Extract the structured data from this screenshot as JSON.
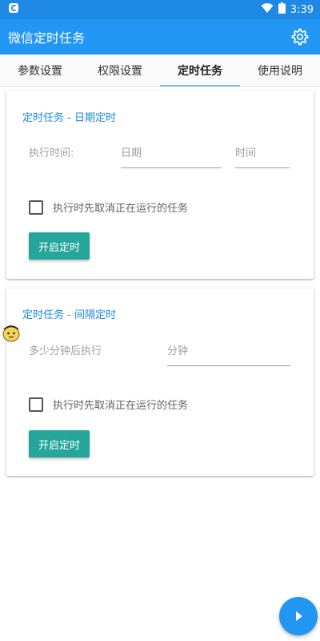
{
  "status_bar": {
    "time": "3:39",
    "icons": [
      "app-notification-icon",
      "wifi-icon",
      "battery-icon"
    ]
  },
  "app_bar": {
    "title": "微信定时任务",
    "settings_icon": "gear-icon"
  },
  "tabs": [
    {
      "label": "参数设置",
      "active": false
    },
    {
      "label": "权限设置",
      "active": false
    },
    {
      "label": "定时任务",
      "active": true
    },
    {
      "label": "使用说明",
      "active": false
    }
  ],
  "date_task": {
    "title": "定时任务 - 日期定时",
    "exec_time_label": "执行时间:",
    "date_placeholder": "日期",
    "time_placeholder": "时间",
    "cancel_checkbox_label": "执行时先取消正在运行的任务",
    "cancel_checked": false,
    "start_button": "开启定时"
  },
  "interval_task": {
    "title": "定时任务 - 间隔定时",
    "minutes_label": "多少分钟后执行",
    "minutes_placeholder": "分钟",
    "cancel_checkbox_label": "执行时先取消正在运行的任务",
    "cancel_checked": false,
    "start_button": "开启定时"
  },
  "fab": {
    "icon": "play-icon"
  },
  "colors": {
    "primary": "#2196f3",
    "status_bar": "#1e88e5",
    "accent_button": "#26a69a",
    "card_title": "#1e88e5"
  }
}
